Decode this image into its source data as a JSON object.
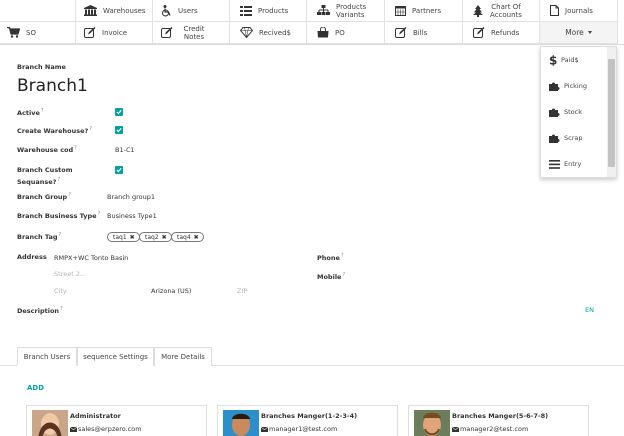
{
  "menu": {
    "row1": [
      {
        "name": "warehouses",
        "label": "Warehouses",
        "icon": "warehouse-icon"
      },
      {
        "name": "users",
        "label": "Users",
        "icon": "wheelchair-icon"
      },
      {
        "name": "products",
        "label": "Products",
        "icon": "list-icon"
      },
      {
        "name": "products-variants",
        "label": "Products Variants",
        "icon": "sitemap-icon"
      },
      {
        "name": "partners",
        "label": "Partners",
        "icon": "calendar-icon"
      },
      {
        "name": "chart-of-accounts",
        "label": "Chart Of Accounts",
        "icon": "tree-icon"
      },
      {
        "name": "journals",
        "label": "Journals",
        "icon": "file-icon"
      }
    ],
    "row2": [
      {
        "name": "so",
        "label": "SO",
        "icon": "cart-icon"
      },
      {
        "name": "invoice",
        "label": "Invoice",
        "icon": "edit-icon"
      },
      {
        "name": "credit-notes",
        "label": "Credit Notes",
        "icon": "edit-icon"
      },
      {
        "name": "recived",
        "label": "Recived$",
        "icon": "diamond-icon"
      },
      {
        "name": "po",
        "label": "PO",
        "icon": "shopping-bag-icon"
      },
      {
        "name": "bills",
        "label": "Bills",
        "icon": "edit-icon"
      },
      {
        "name": "refunds",
        "label": "Refunds",
        "icon": "edit-icon"
      }
    ],
    "more_label": "More",
    "dropdown": [
      {
        "name": "paid",
        "label": "Paid$",
        "icon": "dollar-icon"
      },
      {
        "name": "picking",
        "label": "Picking",
        "icon": "puzzle-icon"
      },
      {
        "name": "stock",
        "label": "Stock",
        "icon": "puzzle-icon"
      },
      {
        "name": "scrap",
        "label": "Scrap",
        "icon": "puzzle-icon"
      },
      {
        "name": "entry",
        "label": "Entry",
        "icon": "bars-icon"
      }
    ]
  },
  "form": {
    "branch_name_label": "Branch Name",
    "branch_name": "Branch1",
    "active_label": "Active",
    "create_warehouse_label": "Create Warehouse?",
    "warehouse_cod_label": "Warehouse cod",
    "warehouse_cod": "B1-C1",
    "custom_seq_label_1": "Branch Custom",
    "custom_seq_label_2": "Sequanse?",
    "branch_group_label": "Branch Group",
    "branch_group": "Branch group1",
    "business_type_label": "Branch Business Type",
    "business_type": "Business Type1",
    "branch_tag_label": "Branch Tag",
    "tags": [
      "taq1",
      "taq2",
      "taq4"
    ],
    "address_label": "Address",
    "street": "RMPX+WC Tonto Basin",
    "street2_placeholder": "Street 2...",
    "city_placeholder": "City",
    "state": "Arizona (US)",
    "zip_placeholder": "ZIP",
    "phone_label": "Phone",
    "mobile_label": "Mobile",
    "description_label": "Description",
    "lang": "EN",
    "help_mark": "?"
  },
  "tabs": [
    "Branch Users",
    "sequence Settings",
    "More Details"
  ],
  "add_label": "ADD",
  "users": [
    {
      "name": "Administrator",
      "email": "sales@erpzero.com"
    },
    {
      "name": "Branches Manger(1-2-3-4)",
      "email": "manager1@test.com"
    },
    {
      "name": "Branches Manger(5-6-7-8)",
      "email": "manager2@test.com"
    }
  ],
  "colors": {
    "accent": "#00a09d",
    "text": "#333333",
    "border": "#dddddd"
  }
}
